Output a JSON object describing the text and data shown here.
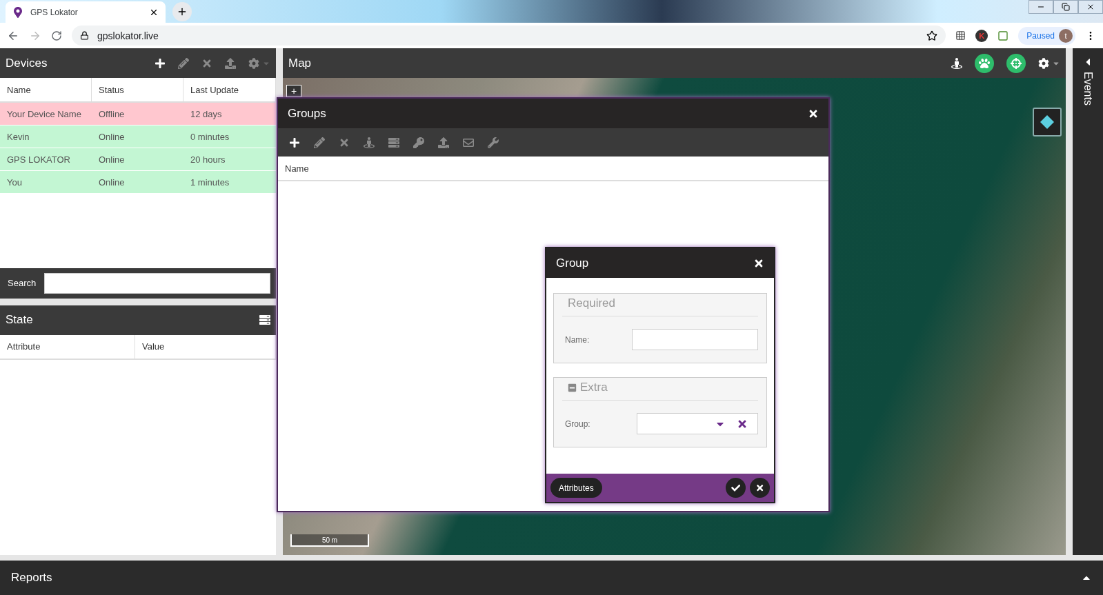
{
  "browser": {
    "tab_title": "GPS Lokator",
    "url": "gpslokator.live",
    "extension_badge": "K",
    "profile_status": "Paused",
    "avatar_letter": "t"
  },
  "devices": {
    "title": "Devices",
    "toolbar": [
      {
        "kind": "add",
        "disabled": false
      },
      {
        "kind": "edit",
        "disabled": true
      },
      {
        "kind": "remove",
        "disabled": true
      },
      {
        "kind": "upload",
        "disabled": true
      },
      {
        "kind": "settings",
        "disabled": true
      }
    ],
    "columns": [
      "Name",
      "Status",
      "Last Update"
    ],
    "rows": [
      {
        "name": "Your Device Name",
        "status": "Offline",
        "online": false,
        "last_update": "12 days"
      },
      {
        "name": "Kevin",
        "status": "Online",
        "online": true,
        "last_update": "0 minutes"
      },
      {
        "name": "GPS LOKATOR",
        "status": "Online",
        "online": true,
        "last_update": "20 hours"
      },
      {
        "name": "You",
        "status": "Online",
        "online": true,
        "last_update": "1 minutes"
      }
    ],
    "search_label": "Search"
  },
  "state": {
    "title": "State",
    "columns": [
      "Attribute",
      "Value"
    ]
  },
  "map": {
    "title": "Map",
    "toolbar": [
      {
        "kind": "person"
      },
      {
        "kind": "paw"
      },
      {
        "kind": "crosshairs"
      },
      {
        "kind": "settings"
      }
    ],
    "zoom_in": "+",
    "scale": "50 m"
  },
  "events": {
    "label": "Events"
  },
  "reports": {
    "label": "Reports"
  },
  "groups_dialog": {
    "title": "Groups",
    "toolbar": [
      {
        "kind": "add",
        "disabled": false
      },
      {
        "kind": "edit",
        "disabled": true
      },
      {
        "kind": "remove",
        "disabled": true
      },
      {
        "kind": "person",
        "disabled": true
      },
      {
        "kind": "list",
        "disabled": true
      },
      {
        "kind": "key",
        "disabled": true
      },
      {
        "kind": "upload",
        "disabled": true
      },
      {
        "kind": "mail",
        "disabled": true
      },
      {
        "kind": "wrench",
        "disabled": true
      }
    ],
    "columns": [
      "Name"
    ]
  },
  "group_dialog": {
    "title": "Group",
    "sections": [
      {
        "title": "Required",
        "collapsible": false,
        "expanded": true,
        "fields": [
          {
            "label": "Name:",
            "kind": "text"
          }
        ]
      },
      {
        "title": "Extra",
        "collapsible": true,
        "expanded": true,
        "fields": [
          {
            "label": "Group:",
            "kind": "combo"
          }
        ]
      }
    ],
    "attributes_button": "Attributes"
  }
}
